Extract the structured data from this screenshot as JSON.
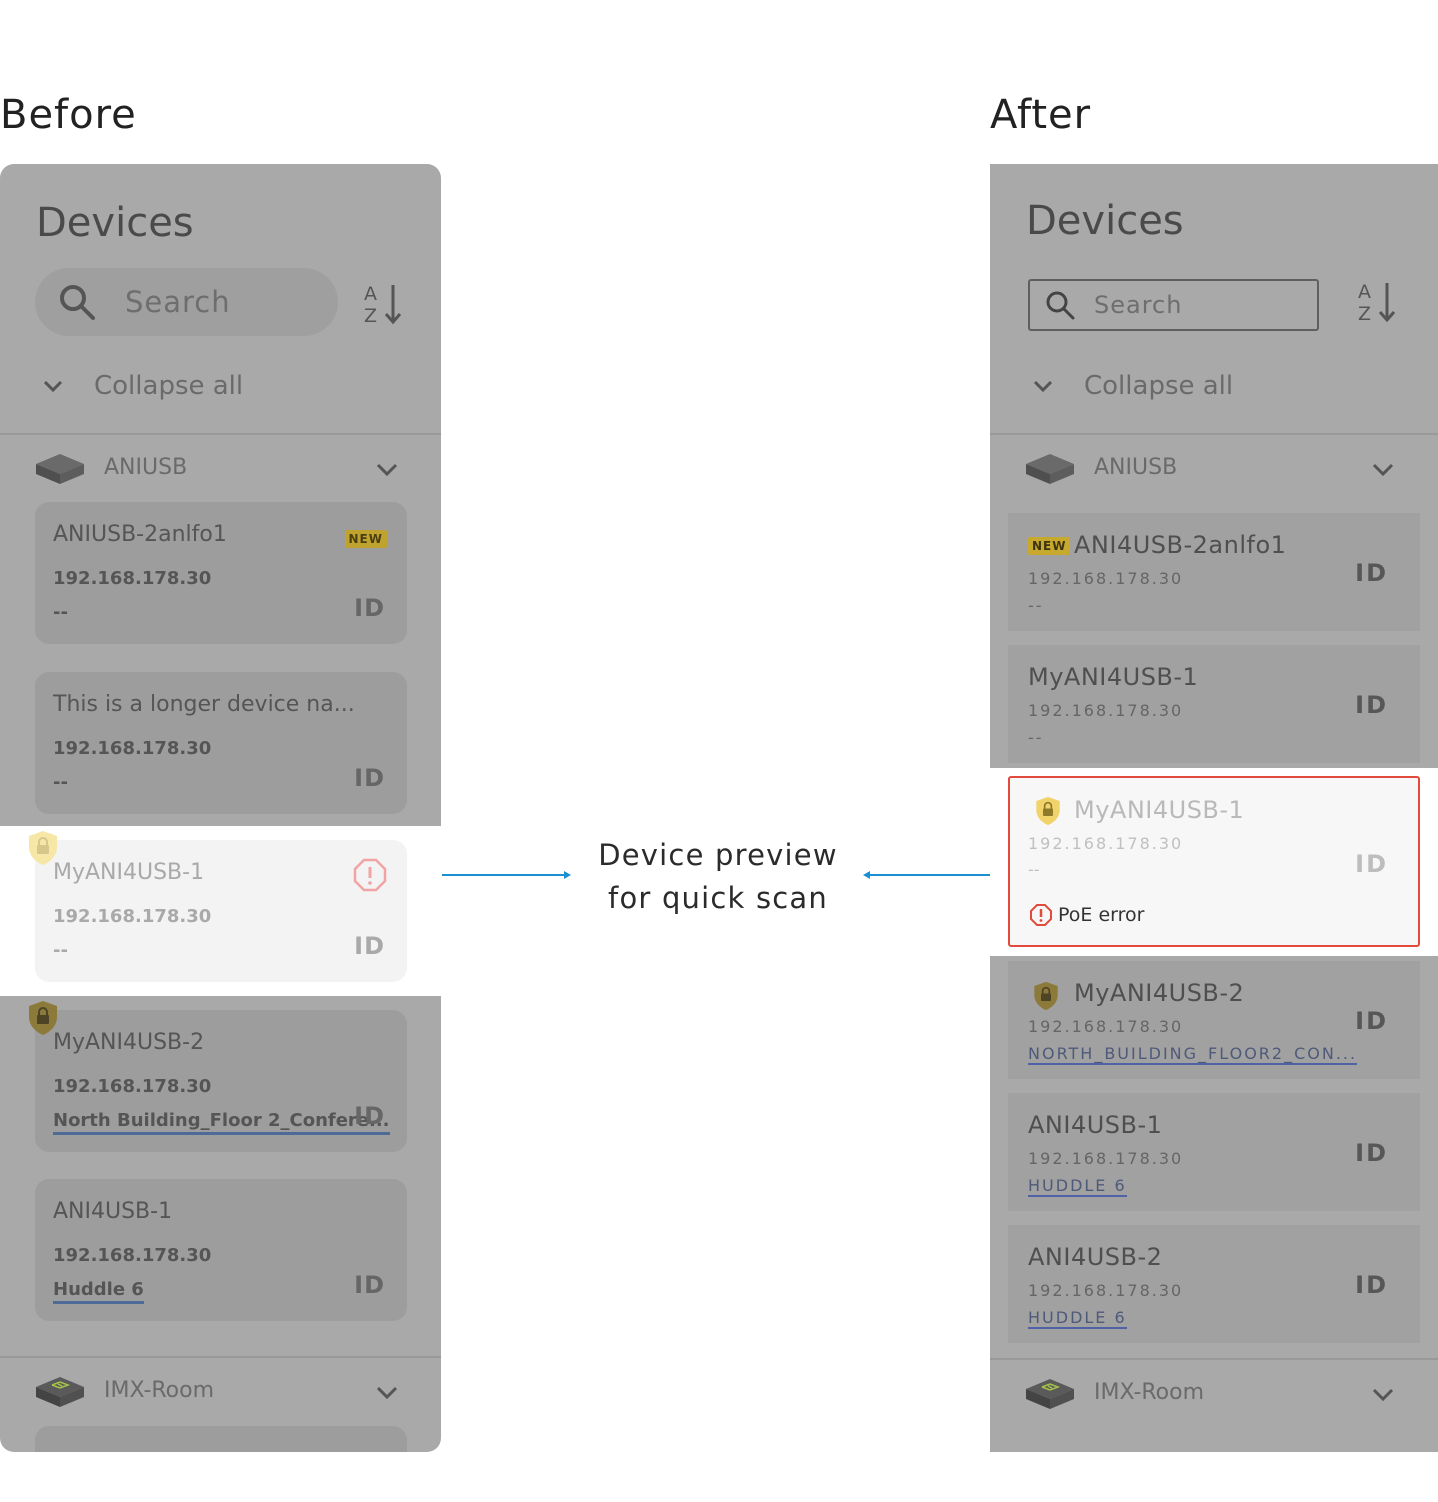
{
  "labels": {
    "before": "Before",
    "after": "After",
    "callout_line1": "Device preview",
    "callout_line2": "for quick scan"
  },
  "before": {
    "title": "Devices",
    "search_placeholder": "Search",
    "collapse_label": "Collapse all",
    "groups": [
      "ANIUSB",
      "IMX-Room"
    ],
    "cards": [
      {
        "name": "ANIUSB-2anlfo1",
        "badge": "NEW",
        "ip": "192.168.178.30",
        "location": "--",
        "id_label": "ID"
      },
      {
        "name": "This is a longer device na...",
        "ip": "192.168.178.30",
        "location": "--",
        "id_label": "ID"
      },
      {
        "name": "MyANI4USB-1",
        "ip": "192.168.178.30",
        "location": "--",
        "id_label": "ID"
      },
      {
        "name": "MyANI4USB-2",
        "ip": "192.168.178.30",
        "location": "North Building_Floor 2_Confere...",
        "id_label": "ID"
      },
      {
        "name": "ANI4USB-1",
        "ip": "192.168.178.30",
        "location": "Huddle 6",
        "id_label": "ID"
      }
    ]
  },
  "after": {
    "title": "Devices",
    "search_placeholder": "Search",
    "collapse_label": "Collapse all",
    "groups": [
      "ANIUSB",
      "IMX-Room"
    ],
    "cards": [
      {
        "name": "ANI4USB-2anlfo1",
        "badge": "NEW",
        "ip": "192.168.178.30",
        "location": "--",
        "id_label": "ID"
      },
      {
        "name": "MyANI4USB-1",
        "ip": "192.168.178.30",
        "location": "--",
        "id_label": "ID"
      },
      {
        "name": "MyANI4USB-1",
        "ip": "192.168.178.30",
        "location": "--",
        "id_label": "ID",
        "error": "PoE error"
      },
      {
        "name": "MyANI4USB-2",
        "ip": "192.168.178.30",
        "location": "NORTH_BUILDING_FLOOR2_CON...",
        "id_label": "ID"
      },
      {
        "name": "ANI4USB-1",
        "ip": "192.168.178.30",
        "location": "HUDDLE 6",
        "id_label": "ID"
      },
      {
        "name": "ANI4USB-2",
        "ip": "192.168.178.30",
        "location": "HUDDLE 6",
        "id_label": "ID"
      }
    ]
  },
  "colors": {
    "panel": "#a9a9a9",
    "error": "#e24a3b",
    "arrow": "#1a8fd1",
    "new_badge": "#c7a92d",
    "link_underline": "#4e62a5"
  }
}
